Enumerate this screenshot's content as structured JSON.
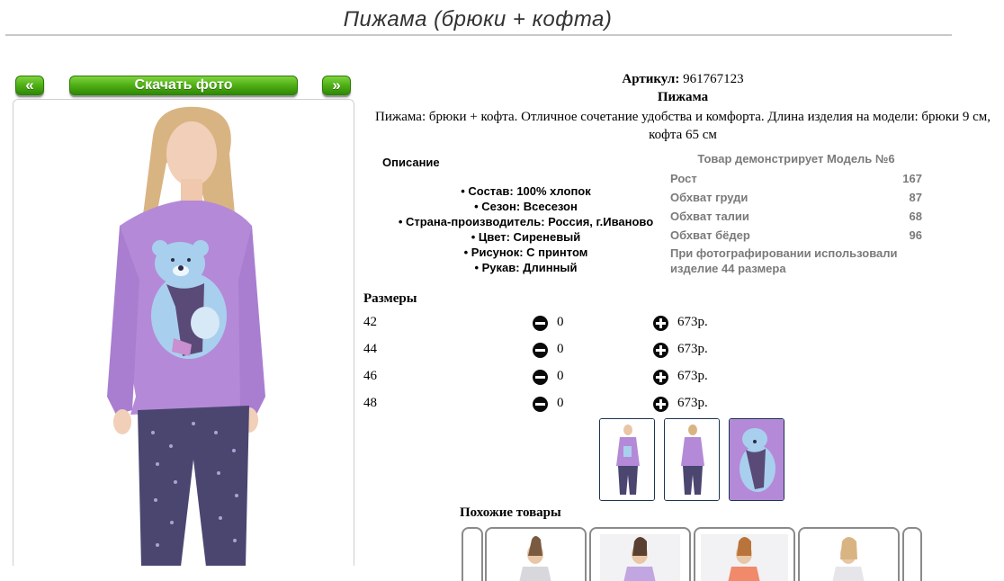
{
  "page": {
    "title": "Пижама (брюки + кофта)"
  },
  "gallery": {
    "prev_label": "«",
    "download_label": "Скачать фото",
    "next_label": "»"
  },
  "product": {
    "article_label": "Артикул:",
    "article_value": "961767123",
    "name": "Пижама",
    "description": "Пижама: брюки + кофта. Отличное сочетание удобства и комфорта. Длина изделия на модели: брюки 9 см, кофта 65 см"
  },
  "specs": {
    "heading": "Описание",
    "items": [
      "Состав: 100% хлопок",
      "Сезон: Всесезон",
      "Страна-производитель: Россия, г.Иваново",
      "Цвет: Сиреневый",
      "Рисунок: С принтом",
      "Рукав: Длинный"
    ]
  },
  "model": {
    "title": "Товар демонстрирует Модель №6",
    "rows": [
      {
        "label": "Рост",
        "value": "167"
      },
      {
        "label": "Обхват груди",
        "value": "87"
      },
      {
        "label": "Обхват талии",
        "value": "68"
      },
      {
        "label": "Обхват бёдер",
        "value": "96"
      }
    ],
    "note": "При фотографировании использовали изделие 44 размера"
  },
  "sizes": {
    "heading": "Размеры",
    "rows": [
      {
        "size": "42",
        "qty": "0",
        "price": "673р."
      },
      {
        "size": "44",
        "qty": "0",
        "price": "673р."
      },
      {
        "size": "46",
        "qty": "0",
        "price": "673р."
      },
      {
        "size": "48",
        "qty": "0",
        "price": "673р."
      }
    ]
  },
  "similar": {
    "heading": "Похожие товары"
  },
  "colors": {
    "button_green": "#4fae15",
    "shirt_lilac": "#b48ad8",
    "pants_navy": "#4a4670",
    "bear_blue": "#a9cfee",
    "thumb_border": "#1c3552"
  }
}
